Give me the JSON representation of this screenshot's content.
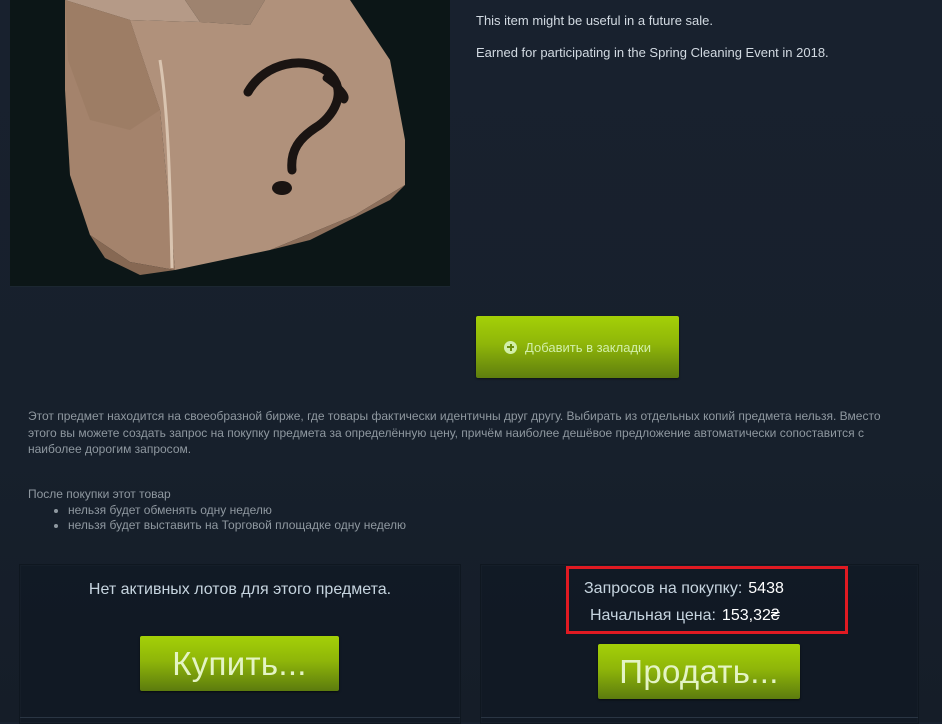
{
  "item": {
    "image_icon": "mystery-box-question-mark",
    "description_line_1": "This item might be useful in a future sale.",
    "description_line_2": "Earned for participating in the Spring Cleaning Event in 2018."
  },
  "bookmark_button": {
    "label": "Добавить в закладки",
    "icon": "plus-circle-icon"
  },
  "market_info": {
    "text": "Этот предмет находится на своеобразной бирже, где товары фактически идентичны друг другу. Выбирать из отдельных копий предмета нельзя. Вместо этого вы можете создать запрос на покупку предмета за определённую цену, причём наиболее дешёвое предложение автоматически сопоставится с наиболее дорогим запросом."
  },
  "restrictions": {
    "heading": "После покупки этот товар",
    "items": [
      "нельзя будет обменять одну неделю",
      "нельзя будет выставить на Торговой площадке одну неделю"
    ]
  },
  "buy_panel": {
    "no_listings_text": "Нет активных лотов для этого предмета.",
    "buy_button_label": "Купить..."
  },
  "sell_panel": {
    "buy_requests_label": "Запросов на покупку:",
    "buy_requests_value": "5438",
    "starting_price_label": "Начальная цена:",
    "starting_price_value": "153,32₴",
    "sell_button_label": "Продать..."
  },
  "colors": {
    "background": "#17202d",
    "button_green": "#8fb609",
    "highlight_red": "#e01a22"
  }
}
